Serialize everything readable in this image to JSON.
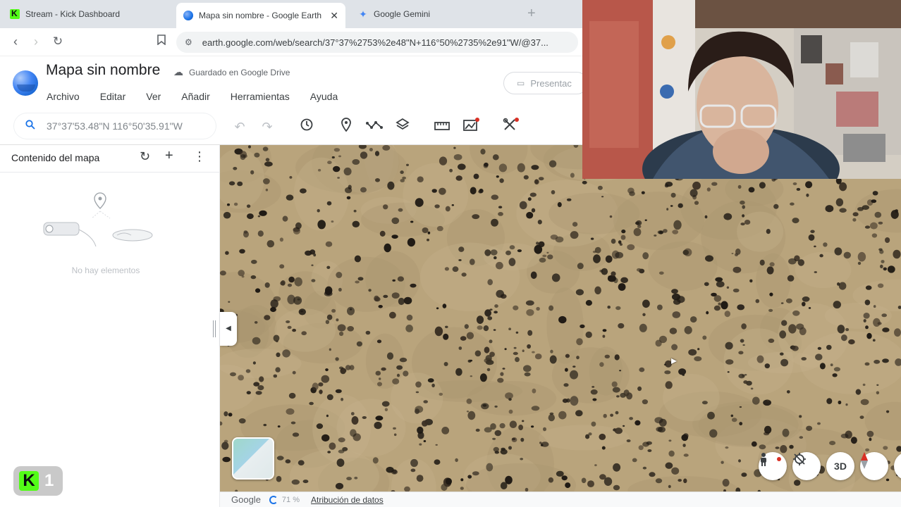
{
  "browser": {
    "tabs": [
      {
        "title": "Stream - Kick Dashboard",
        "favicon": "kick-icon"
      },
      {
        "title": "Mapa sin nombre - Google Earth",
        "favicon": "earth-icon",
        "active": true
      },
      {
        "title": "Google Gemini",
        "favicon": "gemini-icon"
      }
    ],
    "url": "earth.google.com/web/search/37°37%2753%2e48\"N+116°50%2735%2e91\"W/@37..."
  },
  "earth": {
    "doc_title": "Mapa sin nombre",
    "saved_status": "Guardado en Google Drive",
    "menus": [
      "Archivo",
      "Editar",
      "Ver",
      "Añadir",
      "Herramientas",
      "Ayuda"
    ],
    "present_label": "Presentac",
    "search_value": "37°37'53.48\"N 116°50'35.91\"W"
  },
  "sidebar": {
    "title": "Contenido del mapa",
    "empty_text": "No hay elementos"
  },
  "map": {
    "buttons": {
      "three_d": "3D"
    },
    "status": {
      "brand": "Google",
      "progress": "71 %",
      "attribution": "Atribución de datos"
    }
  },
  "overlay": {
    "kick_badge_count": "1"
  },
  "colors": {
    "accent": "#1a73e8",
    "kick_green": "#53fc18",
    "terrain": "#b9a47c"
  }
}
